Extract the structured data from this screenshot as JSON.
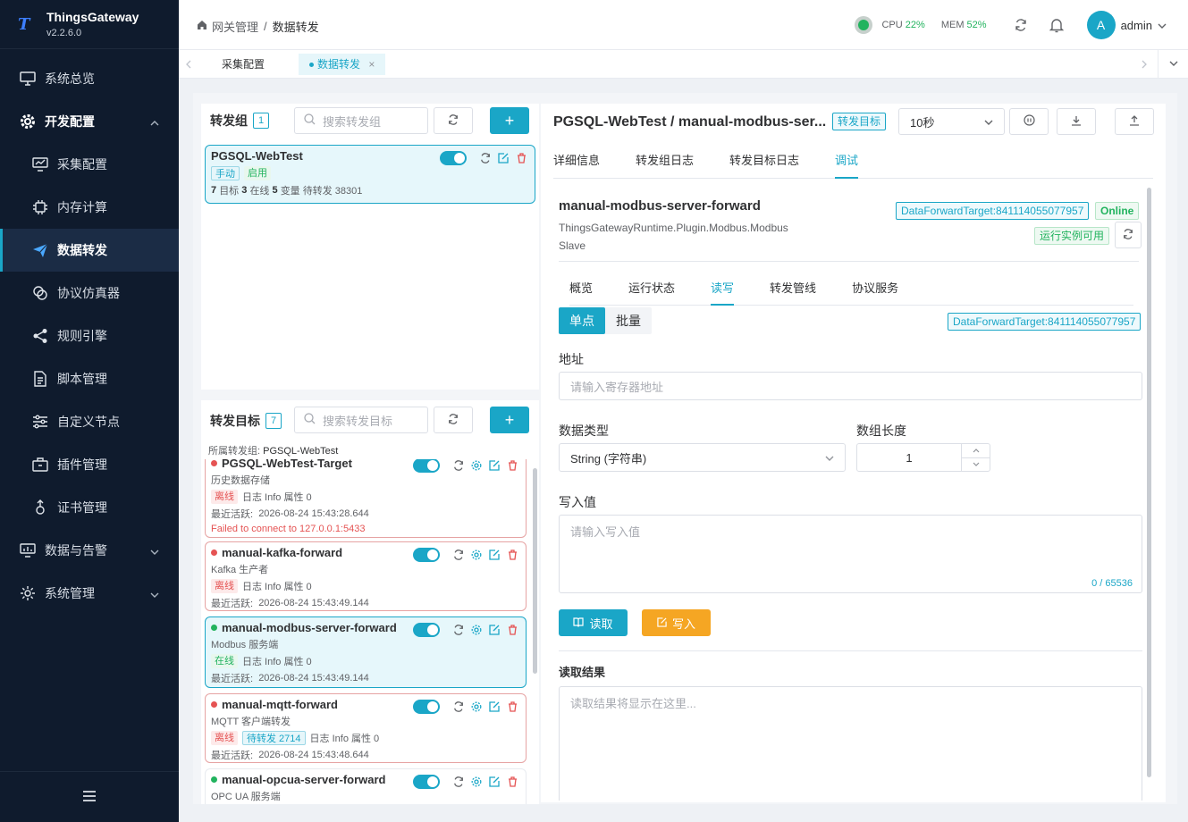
{
  "app": {
    "name": "ThingsGateway",
    "version": "v2.2.6.0",
    "logo_glyph": "T"
  },
  "nav": {
    "items": [
      {
        "label": "系统总览",
        "icon": "monitor-icon"
      },
      {
        "label": "开发配置",
        "icon": "gear-icon"
      },
      {
        "label": "采集配置",
        "icon": "chart-monitor-icon"
      },
      {
        "label": "内存计算",
        "icon": "chip-icon"
      },
      {
        "label": "数据转发",
        "icon": "send-icon"
      },
      {
        "label": "协议仿真器",
        "icon": "link-icon"
      },
      {
        "label": "规则引擎",
        "icon": "share-icon"
      },
      {
        "label": "脚本管理",
        "icon": "document-icon"
      },
      {
        "label": "自定义节点",
        "icon": "sliders-icon"
      },
      {
        "label": "插件管理",
        "icon": "briefcase-icon"
      },
      {
        "label": "证书管理",
        "icon": "certificate-icon"
      },
      {
        "label": "数据与告警",
        "icon": "chart-icon"
      },
      {
        "label": "系统管理",
        "icon": "settings-icon"
      }
    ]
  },
  "header": {
    "breadcrumb_root": "网关管理",
    "breadcrumb_sep": "/",
    "breadcrumb_current": "数据转发",
    "cpu_label": "CPU",
    "cpu_value": "22%",
    "mem_label": "MEM",
    "mem_value": "52%",
    "avatar_letter": "A",
    "user": "admin"
  },
  "tabs": [
    {
      "label": "采集配置"
    },
    {
      "label": "数据转发"
    }
  ],
  "groups": {
    "title": "转发组",
    "count": "1",
    "search_placeholder": "搜索转发组",
    "items": [
      {
        "name": "PGSQL-WebTest",
        "tag1": "手动",
        "tag2": "启用",
        "n1": "7",
        "t1": "目标",
        "n2": "3",
        "t2": "在线",
        "n3": "5",
        "t3": "变量",
        "t4": "待转发 38301"
      }
    ]
  },
  "targets": {
    "title": "转发目标",
    "count": "7",
    "search_placeholder": "搜索转发目标",
    "group_label": "所属转发组:",
    "group_name": "PGSQL-WebTest",
    "items": [
      {
        "name": "PGSQL-WebTest-Target",
        "desc": "历史数据存储",
        "status": "离线",
        "info": "日志 Info 属性 0",
        "last_label": "最近活跃:",
        "last": "2026-08-24 15:43:28.644",
        "error": "Failed to connect to 127.0.0.1:5433"
      },
      {
        "name": "manual-kafka-forward",
        "desc": "Kafka 生产者",
        "status": "离线",
        "info": "日志 Info 属性 0",
        "last_label": "最近活跃:",
        "last": "2026-08-24 15:43:49.144"
      },
      {
        "name": "manual-modbus-server-forward",
        "desc": "Modbus 服务端",
        "status": "在线",
        "info": "日志 Info 属性 0",
        "last_label": "最近活跃:",
        "last": "2026-08-24 15:43:49.144"
      },
      {
        "name": "manual-mqtt-forward",
        "desc": "MQTT 客户端转发",
        "status": "离线",
        "pending": "待转发 2714",
        "info": "日志 Info 属性 0",
        "last_label": "最近活跃:",
        "last": "2026-08-24 15:43:48.644"
      },
      {
        "name": "manual-opcua-server-forward",
        "desc": "OPC UA 服务端"
      }
    ]
  },
  "detail": {
    "title": "PGSQL-WebTest / manual-modbus-ser...",
    "tag": "转发目标",
    "interval": "10秒",
    "tabs": [
      "详细信息",
      "转发组日志",
      "转发目标日志",
      "调试"
    ],
    "target_name": "manual-modbus-server-forward",
    "plugin_line1": "ThingsGatewayRuntime.Plugin.Modbus.Modbus",
    "plugin_line2": "Slave",
    "target_id": "DataForwardTarget:841114055077957",
    "online": "Online",
    "runtime_ok": "运行实例可用",
    "subtabs": [
      "概览",
      "运行状态",
      "读写",
      "转发管线",
      "协议服务"
    ],
    "mode_single": "单点",
    "mode_batch": "批量",
    "address_label": "地址",
    "address_placeholder": "请输入寄存器地址",
    "datatype_label": "数据类型",
    "datatype_value": "String (字符串)",
    "arraylen_label": "数组长度",
    "arraylen_value": "1",
    "write_label": "写入值",
    "write_placeholder": "请输入写入值",
    "char_count": "0 / 65536",
    "read_btn": "读取",
    "write_btn": "写入",
    "result_label": "读取结果",
    "result_placeholder": "读取结果将显示在这里..."
  }
}
